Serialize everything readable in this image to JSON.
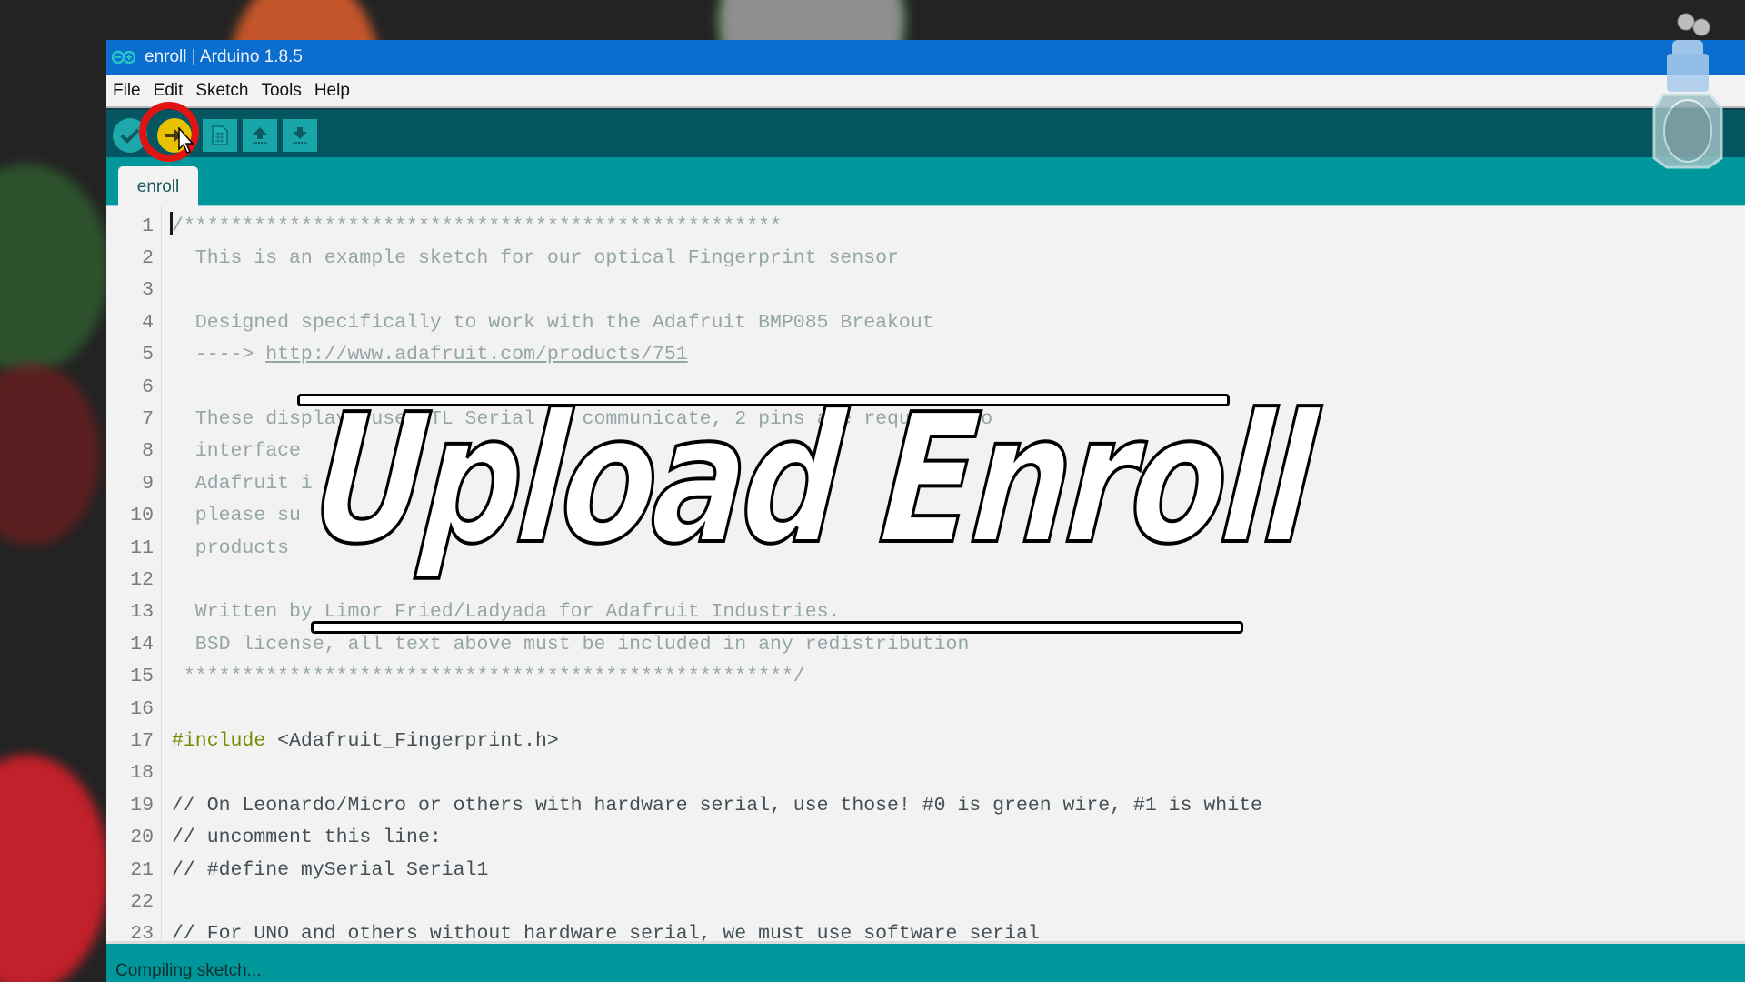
{
  "window": {
    "title": "enroll | Arduino 1.8.5",
    "app_icon": "arduino-infinity-icon"
  },
  "menubar": {
    "items": [
      "File",
      "Edit",
      "Sketch",
      "Tools",
      "Help"
    ]
  },
  "toolbar": {
    "buttons": [
      {
        "name": "verify",
        "icon": "checkmark-icon"
      },
      {
        "name": "upload",
        "icon": "arrow-right-icon",
        "highlighted": true
      },
      {
        "name": "new",
        "icon": "new-file-icon"
      },
      {
        "name": "open",
        "icon": "arrow-up-icon"
      },
      {
        "name": "save",
        "icon": "arrow-down-icon"
      }
    ],
    "highlight_color": "#e11414",
    "upload_color": "#e8c200"
  },
  "tabs": [
    {
      "label": "enroll",
      "active": true
    }
  ],
  "editor": {
    "lines": [
      {
        "n": "1",
        "text": "/***************************************************",
        "style": "comment"
      },
      {
        "n": "2",
        "text": "  This is an example sketch for our optical Fingerprint sensor",
        "style": "comment"
      },
      {
        "n": "3",
        "text": "",
        "style": "comment"
      },
      {
        "n": "4",
        "text": "  Designed specifically to work with the Adafruit BMP085 Breakout",
        "style": "comment"
      },
      {
        "n": "5",
        "text": "  ----> ",
        "link": "http://www.adafruit.com/products/751",
        "style": "comment"
      },
      {
        "n": "6",
        "text": "",
        "style": "comment"
      },
      {
        "n": "7",
        "text": "  These displays use TTL Serial to communicate, 2 pins are required to",
        "style": "comment"
      },
      {
        "n": "8",
        "text": "  interface",
        "style": "comment"
      },
      {
        "n": "9",
        "text": "  Adafruit i",
        "style": "comment"
      },
      {
        "n": "10",
        "text": "  please su",
        "style": "comment"
      },
      {
        "n": "11",
        "text": "  products",
        "style": "comment"
      },
      {
        "n": "12",
        "text": "",
        "style": "comment"
      },
      {
        "n": "13",
        "text": "  Written by Limor Fried/Ladyada for Adafruit Industries.",
        "style": "comment"
      },
      {
        "n": "14",
        "text": "  BSD license, all text above must be included in any redistribution",
        "style": "comment"
      },
      {
        "n": "15",
        "text": " ****************************************************/",
        "style": "comment"
      },
      {
        "n": "16",
        "text": "",
        "style": "comment"
      },
      {
        "n": "17",
        "directive": "#include",
        "text": " <Adafruit_Fingerprint.h>",
        "style": "include"
      },
      {
        "n": "18",
        "text": "",
        "style": "code"
      },
      {
        "n": "19",
        "text": "// On Leonardo/Micro or others with hardware serial, use those! #0 is green wire, #1 is white",
        "style": "code"
      },
      {
        "n": "20",
        "text": "// uncomment this line:",
        "style": "code"
      },
      {
        "n": "21",
        "text": "// #define mySerial Serial1",
        "style": "code"
      },
      {
        "n": "22",
        "text": "",
        "style": "code"
      },
      {
        "n": "23",
        "text": "// For UNO and others without hardware serial, we must use software serial",
        "style": "code"
      }
    ]
  },
  "status": {
    "message": "Compiling sketch..."
  },
  "overlay": {
    "caption": "Upload Enroll"
  },
  "colors": {
    "titlebar": "#0b6dcd",
    "toolbar": "#055660",
    "tabstrip": "#00979c",
    "statusbar": "#00979c",
    "comment": "#95a5a6",
    "code": "#434f54",
    "directive": "#728e00"
  }
}
